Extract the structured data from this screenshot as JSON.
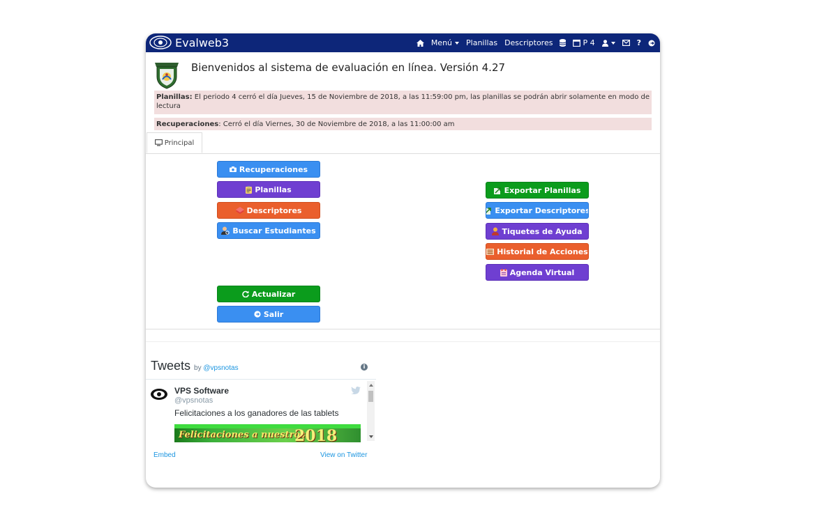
{
  "app": {
    "brand": "Evalweb3"
  },
  "navbar": {
    "menu_label": "Menú",
    "planillas": "Planillas",
    "descriptores": "Descriptores",
    "period": "P 4",
    "help": "?"
  },
  "header": {
    "welcome": "Bienvenidos al sistema de evaluación en línea. Versión 4.27"
  },
  "alerts": {
    "planillas_label": "Planillas:",
    "planillas_text": " El periodo 4 cerró el día Jueves, 15 de Noviembre de 2018, a las 11:59:00 pm, las planillas se podrán abrir solamente en modo de lectura",
    "recuperaciones_label": "Recuperaciones",
    "recuperaciones_text": ": Cerró el día Viernes, 30 de Noviembre de 2018, a las 11:00:00 am"
  },
  "tabs": {
    "principal": "Principal"
  },
  "left_buttons": {
    "recuperaciones": "Recuperaciones",
    "planillas": "Planillas",
    "descriptores": "Descriptores",
    "buscar": "Buscar Estudiantes",
    "actualizar": "Actualizar",
    "salir": "Salir"
  },
  "right_buttons": {
    "exportar_planillas": "Exportar Planillas",
    "exportar_descriptores": "Exportar Descriptores",
    "tiquetes": "Tiquetes de Ayuda",
    "historial": "Historial de Acciones",
    "agenda": "Agenda Virtual"
  },
  "twitter": {
    "title": "Tweets",
    "by": "by",
    "handle_link": "@vpsnotas",
    "author_name": "VPS Software",
    "author_handle": "@vpsnotas",
    "tweet_text": "Felicitaciones a los ganadores de las tablets",
    "image_text": "Felicitaciones a nuestros",
    "image_year": "2018",
    "embed": "Embed",
    "view_on_twitter": "View on Twitter"
  },
  "colors": {
    "navbar": "#0d2679",
    "blue": "#3a8ff1",
    "purple": "#6f3fd1",
    "orange": "#ea5f2d",
    "green": "#0b9c1c",
    "alert_bg": "#f2dede"
  }
}
